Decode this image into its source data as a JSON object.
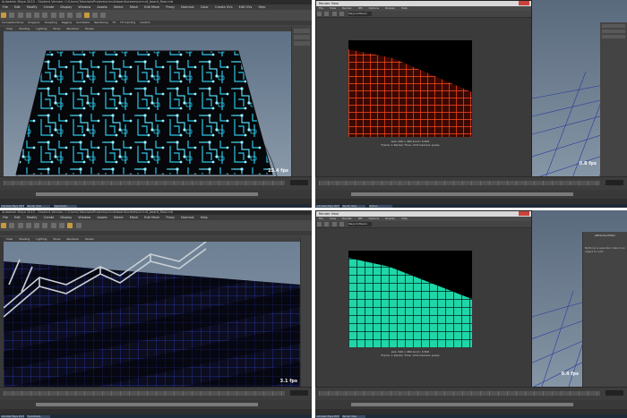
{
  "panels": [
    {
      "title": "Autodesk Maya 2015 - Student Version: C:\\Users\\Tutorials\\Projects\\circuitboard\\scenes\\circuit_board_floor.mb",
      "menus": [
        "File",
        "Edit",
        "Modify",
        "Create",
        "Display",
        "Window",
        "Assets",
        "Select",
        "Mesh",
        "Edit Mesh",
        "Proxy",
        "Normals",
        "Color",
        "Create UVs",
        "Edit UVs",
        "Help"
      ],
      "shelf_tabs": [
        "Curves/Surfaces",
        "Polygons",
        "Sculpting",
        "Rigging",
        "Animation",
        "Rendering",
        "FX",
        "FX Caching",
        "Custom",
        "Arnold",
        "Bifrost",
        "MASH",
        "Motion Graphics",
        "XGen"
      ],
      "viewport_menu": [
        "View",
        "Shading",
        "Lighting",
        "Show",
        "Renderer",
        "Panels"
      ],
      "fps": "25.4 fps"
    },
    {
      "render_title": "Render View",
      "render_menus": [
        "File",
        "View",
        "Render",
        "IPR",
        "Options",
        "Display",
        "Help"
      ],
      "renderer": "Maya Software",
      "stats": [
        "size: 640 x 480  zoom: 0.500",
        "Frame: 1   Render Time: 0:03   Camera: persp"
      ],
      "fps": "0.8 fps"
    },
    {
      "title": "Autodesk Maya 2015 - Student Version: C:\\Users\\Tutorials\\Projects\\circuitboard\\scenes\\circuit_board_floor.mb",
      "menus": [
        "File",
        "Edit",
        "Modify",
        "Create",
        "Display",
        "Window",
        "Assets",
        "Select",
        "Mesh",
        "Edit Mesh",
        "Proxy",
        "Normals",
        "Color",
        "Create UVs",
        "Edit UVs",
        "Help"
      ],
      "viewport_menu": [
        "View",
        "Shading",
        "Lighting",
        "Show",
        "Renderer",
        "Panels"
      ],
      "fps": "3.1 fps"
    },
    {
      "render_title": "Render View",
      "render_menus": [
        "File",
        "View",
        "Render",
        "IPR",
        "Options",
        "Display",
        "Help"
      ],
      "renderer": "Maya Software",
      "stats": [
        "size: 640 x 480  zoom: 0.500",
        "Frame: 1   Render Time: 0:04   Camera: persp"
      ],
      "fps": "0.4 fps",
      "attr_title": "Attribute Editor",
      "attr_text": "Nothing is selected. Select an object to edit."
    }
  ],
  "colors": {
    "circuit": "#29c6e8",
    "grid_red": "#e0341e",
    "grid_teal": "#1fd6a8",
    "grid_blue": "#1e2a9a"
  },
  "taskbar": [
    "Autodesk Maya 2015",
    "Render View",
    "Hypershade",
    "Outliner"
  ]
}
